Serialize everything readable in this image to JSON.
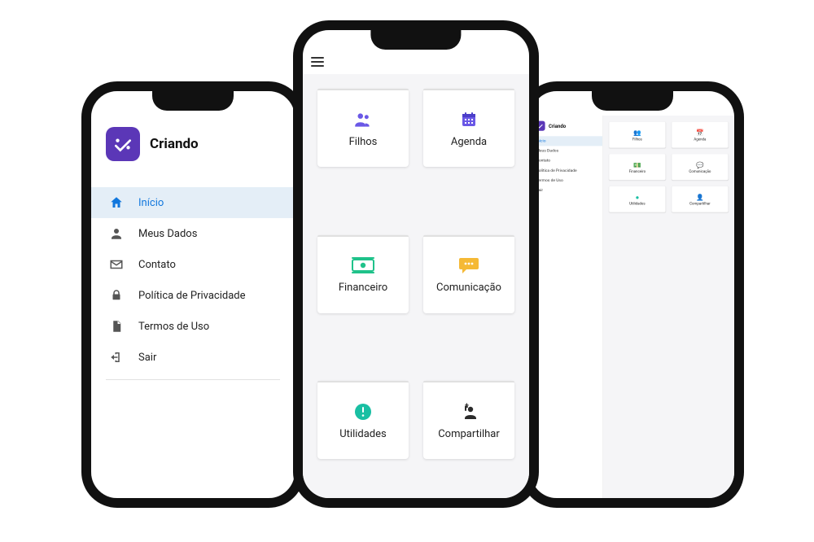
{
  "app": {
    "name": "Criando"
  },
  "sidebar": {
    "items": [
      {
        "label": "Início",
        "icon": "home-icon",
        "active": true
      },
      {
        "label": "Meus Dados",
        "icon": "person-icon"
      },
      {
        "label": "Contato",
        "icon": "mail-icon"
      },
      {
        "label": "Política de Privacidade",
        "icon": "lock-icon"
      },
      {
        "label": "Termos de Uso",
        "icon": "doc-icon"
      },
      {
        "label": "Sair",
        "icon": "exit-icon"
      }
    ]
  },
  "home_cards": [
    {
      "label": "Filhos",
      "icon": "people-icon",
      "color": "purple"
    },
    {
      "label": "Agenda",
      "icon": "calendar-icon",
      "color": "purple"
    },
    {
      "label": "Financeiro",
      "icon": "money-icon",
      "color": "green"
    },
    {
      "label": "Comunicação",
      "icon": "chat-icon",
      "color": "yellow"
    },
    {
      "label": "Utilidades",
      "icon": "alert-icon",
      "color": "teal"
    },
    {
      "label": "Compartilhar",
      "icon": "share-icon",
      "color": "dark"
    }
  ],
  "colors": {
    "brand_bg": "#5b37b7",
    "active_bg": "#e4eef7",
    "active_fg": "#1177dd"
  }
}
